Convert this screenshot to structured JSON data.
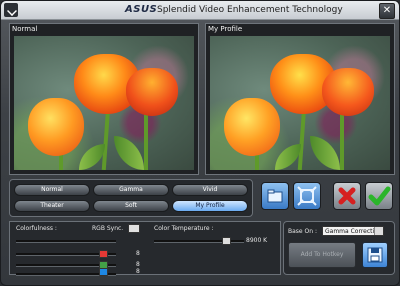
{
  "window": {
    "brand": "ASUS",
    "title": "Splendid Video Enhancement Technology"
  },
  "panels": {
    "left_label": "Normal",
    "right_label": "My Profile"
  },
  "modes": [
    {
      "label": "Normal",
      "active": false
    },
    {
      "label": "Gamma",
      "active": false
    },
    {
      "label": "Vivid",
      "active": false
    },
    {
      "label": "Theater",
      "active": false
    },
    {
      "label": "Soft",
      "active": false
    },
    {
      "label": "My Profile",
      "active": true
    }
  ],
  "adjust": {
    "colorfulness_label": "Colorfulness :",
    "rgb_sync_label": "RGB Sync.",
    "color_temp_label": "Color Temperature :",
    "color_temp_value": "8900 K",
    "channels": [
      {
        "color": "#e53935",
        "value": "8"
      },
      {
        "color": "#43a047",
        "value": "8"
      },
      {
        "color": "#1e88e5",
        "value": "8"
      }
    ]
  },
  "base": {
    "label": "Base On :",
    "selected": "Gamma Correction",
    "add_label": "Add To Hotkey"
  },
  "colors": {
    "accent": "#3a7ac6",
    "active_mode": "#6aaaf0"
  }
}
